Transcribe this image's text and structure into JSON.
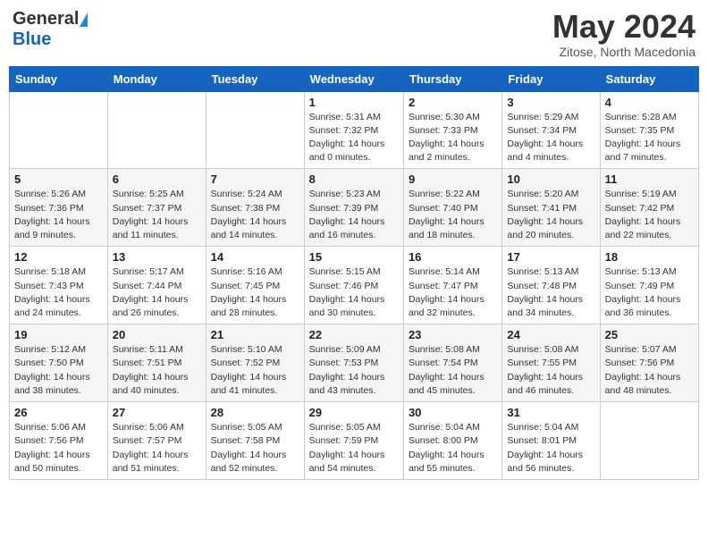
{
  "header": {
    "logo_general": "General",
    "logo_blue": "Blue",
    "month_title": "May 2024",
    "subtitle": "Zitose, North Macedonia"
  },
  "days_of_week": [
    "Sunday",
    "Monday",
    "Tuesday",
    "Wednesday",
    "Thursday",
    "Friday",
    "Saturday"
  ],
  "weeks": [
    [
      {
        "day": "",
        "info": ""
      },
      {
        "day": "",
        "info": ""
      },
      {
        "day": "",
        "info": ""
      },
      {
        "day": "1",
        "info": "Sunrise: 5:31 AM\nSunset: 7:32 PM\nDaylight: 14 hours\nand 0 minutes."
      },
      {
        "day": "2",
        "info": "Sunrise: 5:30 AM\nSunset: 7:33 PM\nDaylight: 14 hours\nand 2 minutes."
      },
      {
        "day": "3",
        "info": "Sunrise: 5:29 AM\nSunset: 7:34 PM\nDaylight: 14 hours\nand 4 minutes."
      },
      {
        "day": "4",
        "info": "Sunrise: 5:28 AM\nSunset: 7:35 PM\nDaylight: 14 hours\nand 7 minutes."
      }
    ],
    [
      {
        "day": "5",
        "info": "Sunrise: 5:26 AM\nSunset: 7:36 PM\nDaylight: 14 hours\nand 9 minutes."
      },
      {
        "day": "6",
        "info": "Sunrise: 5:25 AM\nSunset: 7:37 PM\nDaylight: 14 hours\nand 11 minutes."
      },
      {
        "day": "7",
        "info": "Sunrise: 5:24 AM\nSunset: 7:38 PM\nDaylight: 14 hours\nand 14 minutes."
      },
      {
        "day": "8",
        "info": "Sunrise: 5:23 AM\nSunset: 7:39 PM\nDaylight: 14 hours\nand 16 minutes."
      },
      {
        "day": "9",
        "info": "Sunrise: 5:22 AM\nSunset: 7:40 PM\nDaylight: 14 hours\nand 18 minutes."
      },
      {
        "day": "10",
        "info": "Sunrise: 5:20 AM\nSunset: 7:41 PM\nDaylight: 14 hours\nand 20 minutes."
      },
      {
        "day": "11",
        "info": "Sunrise: 5:19 AM\nSunset: 7:42 PM\nDaylight: 14 hours\nand 22 minutes."
      }
    ],
    [
      {
        "day": "12",
        "info": "Sunrise: 5:18 AM\nSunset: 7:43 PM\nDaylight: 14 hours\nand 24 minutes."
      },
      {
        "day": "13",
        "info": "Sunrise: 5:17 AM\nSunset: 7:44 PM\nDaylight: 14 hours\nand 26 minutes."
      },
      {
        "day": "14",
        "info": "Sunrise: 5:16 AM\nSunset: 7:45 PM\nDaylight: 14 hours\nand 28 minutes."
      },
      {
        "day": "15",
        "info": "Sunrise: 5:15 AM\nSunset: 7:46 PM\nDaylight: 14 hours\nand 30 minutes."
      },
      {
        "day": "16",
        "info": "Sunrise: 5:14 AM\nSunset: 7:47 PM\nDaylight: 14 hours\nand 32 minutes."
      },
      {
        "day": "17",
        "info": "Sunrise: 5:13 AM\nSunset: 7:48 PM\nDaylight: 14 hours\nand 34 minutes."
      },
      {
        "day": "18",
        "info": "Sunrise: 5:13 AM\nSunset: 7:49 PM\nDaylight: 14 hours\nand 36 minutes."
      }
    ],
    [
      {
        "day": "19",
        "info": "Sunrise: 5:12 AM\nSunset: 7:50 PM\nDaylight: 14 hours\nand 38 minutes."
      },
      {
        "day": "20",
        "info": "Sunrise: 5:11 AM\nSunset: 7:51 PM\nDaylight: 14 hours\nand 40 minutes."
      },
      {
        "day": "21",
        "info": "Sunrise: 5:10 AM\nSunset: 7:52 PM\nDaylight: 14 hours\nand 41 minutes."
      },
      {
        "day": "22",
        "info": "Sunrise: 5:09 AM\nSunset: 7:53 PM\nDaylight: 14 hours\nand 43 minutes."
      },
      {
        "day": "23",
        "info": "Sunrise: 5:08 AM\nSunset: 7:54 PM\nDaylight: 14 hours\nand 45 minutes."
      },
      {
        "day": "24",
        "info": "Sunrise: 5:08 AM\nSunset: 7:55 PM\nDaylight: 14 hours\nand 46 minutes."
      },
      {
        "day": "25",
        "info": "Sunrise: 5:07 AM\nSunset: 7:56 PM\nDaylight: 14 hours\nand 48 minutes."
      }
    ],
    [
      {
        "day": "26",
        "info": "Sunrise: 5:06 AM\nSunset: 7:56 PM\nDaylight: 14 hours\nand 50 minutes."
      },
      {
        "day": "27",
        "info": "Sunrise: 5:06 AM\nSunset: 7:57 PM\nDaylight: 14 hours\nand 51 minutes."
      },
      {
        "day": "28",
        "info": "Sunrise: 5:05 AM\nSunset: 7:58 PM\nDaylight: 14 hours\nand 52 minutes."
      },
      {
        "day": "29",
        "info": "Sunrise: 5:05 AM\nSunset: 7:59 PM\nDaylight: 14 hours\nand 54 minutes."
      },
      {
        "day": "30",
        "info": "Sunrise: 5:04 AM\nSunset: 8:00 PM\nDaylight: 14 hours\nand 55 minutes."
      },
      {
        "day": "31",
        "info": "Sunrise: 5:04 AM\nSunset: 8:01 PM\nDaylight: 14 hours\nand 56 minutes."
      },
      {
        "day": "",
        "info": ""
      }
    ]
  ]
}
